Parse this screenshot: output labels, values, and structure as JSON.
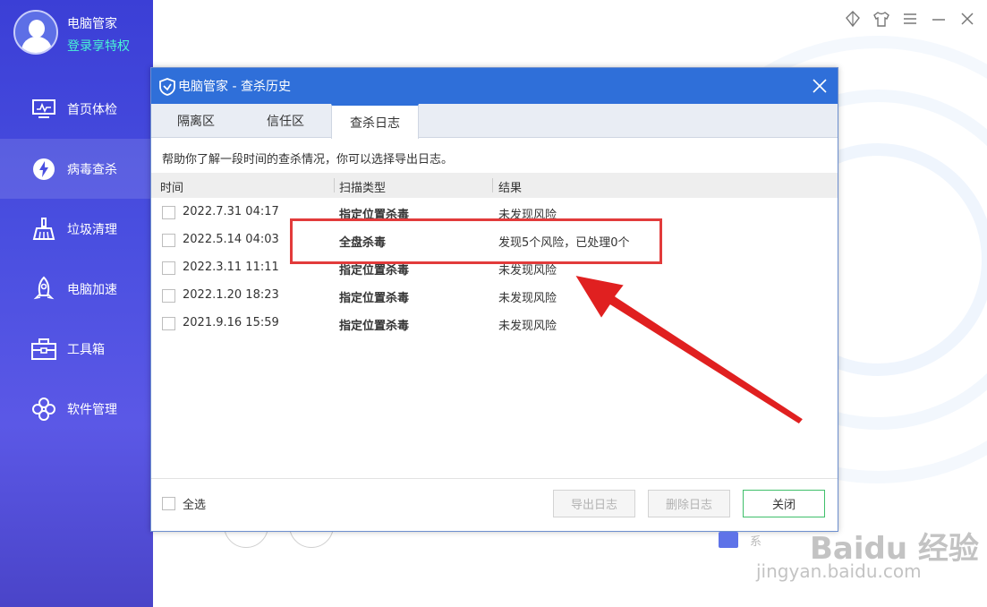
{
  "profile": {
    "name": "电脑管家",
    "subtitle": "登录享特权"
  },
  "sidebar": {
    "items": [
      {
        "label": "首页体检",
        "icon": "monitor-icon"
      },
      {
        "label": "病毒查杀",
        "icon": "lightning-shield-icon",
        "active": true
      },
      {
        "label": "垃圾清理",
        "icon": "broom-icon"
      },
      {
        "label": "电脑加速",
        "icon": "rocket-icon"
      },
      {
        "label": "工具箱",
        "icon": "toolbox-icon"
      },
      {
        "label": "软件管理",
        "icon": "clover-icon"
      }
    ]
  },
  "window_controls": [
    "skin-icon",
    "shirt-icon",
    "menu-icon",
    "minimize-icon",
    "close-icon"
  ],
  "dialog": {
    "title": "电脑管家 - 查杀历史",
    "tabs": [
      {
        "label": "隔离区"
      },
      {
        "label": "信任区"
      },
      {
        "label": "查杀日志",
        "active": true
      }
    ],
    "description": "帮助你了解一段时间的查杀情况，你可以选择导出日志。",
    "columns": [
      "时间",
      "扫描类型",
      "结果"
    ],
    "rows": [
      {
        "time": "2022.7.31 04:17",
        "type": "指定位置杀毒",
        "result": "未发现风险"
      },
      {
        "time": "2022.5.14 04:03",
        "type": "全盘杀毒",
        "result": "发现5个风险，已处理0个"
      },
      {
        "time": "2022.3.11 11:11",
        "type": "指定位置杀毒",
        "result": "未发现风险"
      },
      {
        "time": "2022.1.20 18:23",
        "type": "指定位置杀毒",
        "result": "未发现风险"
      },
      {
        "time": "2021.9.16 15:59",
        "type": "指定位置杀毒",
        "result": "未发现风险"
      }
    ],
    "select_all": "全选",
    "buttons": {
      "export": "导出日志",
      "delete": "删除日志",
      "close": "关闭"
    }
  },
  "background": {
    "partial_text": "系"
  },
  "watermark": {
    "brand": "Baidu 经验",
    "url": "jingyan.baidu.com"
  },
  "colors": {
    "sidebar": "#4a4fe0",
    "titlebar": "#2f6fd9",
    "accent_text": "#49f3d5",
    "highlight": "#e23b3b",
    "close_border": "#3fbf6a"
  }
}
